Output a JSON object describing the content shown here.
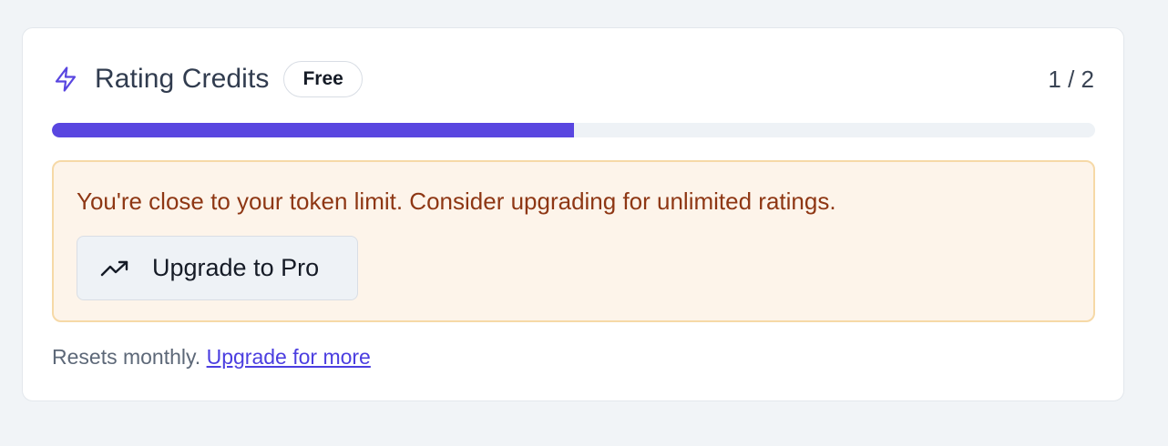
{
  "card": {
    "title": "Rating Credits",
    "badge": "Free",
    "count": "1 / 2",
    "title_icon": "bolt-icon"
  },
  "usage": {
    "used": 1,
    "limit": 2,
    "fill_fraction": 0.5
  },
  "alert": {
    "message": "You're close to your token limit. Consider upgrading for unlimited ratings.",
    "button_label": "Upgrade to Pro",
    "button_icon": "trending-up-icon"
  },
  "footer": {
    "text": "Resets monthly. ",
    "link": "Upgrade for more"
  },
  "colors": {
    "accent": "#5946e0",
    "alert_bg": "#fdf4ea",
    "alert_border": "#f6d9a7",
    "alert_text": "#8e3714"
  }
}
